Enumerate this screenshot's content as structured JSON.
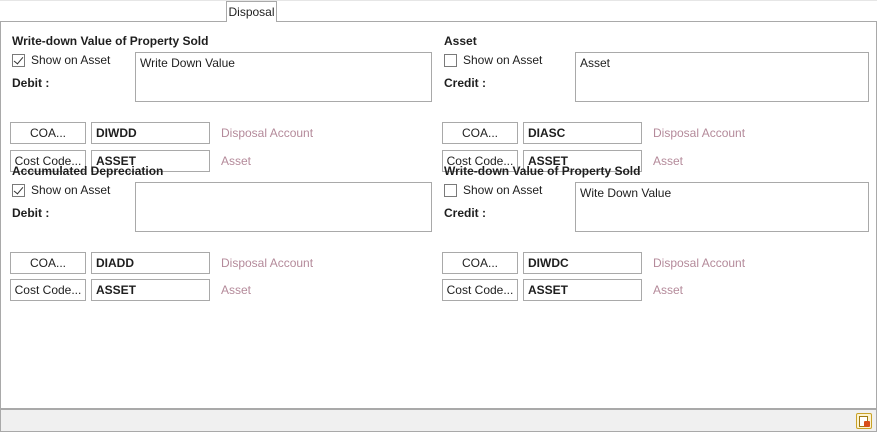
{
  "tab": {
    "label": "Disposal"
  },
  "sections": [
    {
      "title": "Write-down Value of Property Sold",
      "show_on_asset_label": "Show on Asset",
      "show_on_asset_checked": true,
      "side_label": "Debit :",
      "memo": "Write Down Value",
      "coa_button": "COA...",
      "coa_code": "DIWDD",
      "coa_desc": "Disposal Account",
      "cost_button": "Cost Code...",
      "cost_code": "ASSET",
      "cost_desc": "Asset"
    },
    {
      "title": "Asset",
      "show_on_asset_label": "Show on Asset",
      "show_on_asset_checked": false,
      "side_label": "Credit :",
      "memo": "Asset",
      "coa_button": "COA...",
      "coa_code": "DIASC",
      "coa_desc": "Disposal Account",
      "cost_button": "Cost Code...",
      "cost_code": "ASSET",
      "cost_desc": "Asset"
    },
    {
      "title": "Accumulated Depreciation",
      "show_on_asset_label": "Show on Asset",
      "show_on_asset_checked": true,
      "side_label": "Debit :",
      "memo": "",
      "coa_button": "COA...",
      "coa_code": "DIADD",
      "coa_desc": "Disposal Account",
      "cost_button": "Cost Code...",
      "cost_code": "ASSET",
      "cost_desc": "Asset"
    },
    {
      "title": "Write-down Value of Property Sold",
      "show_on_asset_label": "Show on Asset",
      "show_on_asset_checked": false,
      "side_label": "Credit :",
      "memo": "Wite Down Value",
      "coa_button": "COA...",
      "coa_code": "DIWDC",
      "coa_desc": "Disposal Account",
      "cost_button": "Cost Code...",
      "cost_code": "ASSET",
      "cost_desc": "Asset"
    }
  ],
  "statusbar": {
    "icon": "report-icon"
  }
}
